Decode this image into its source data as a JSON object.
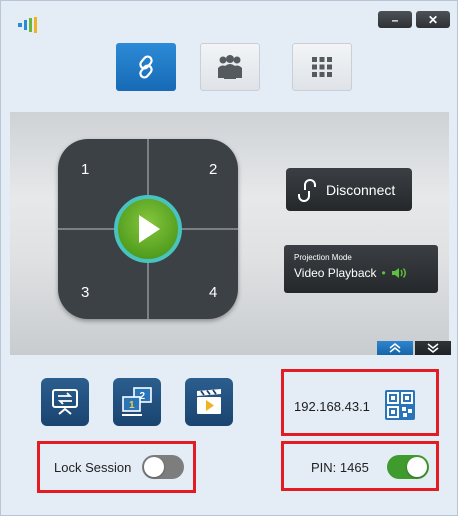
{
  "window": {
    "minimize_symbol": "–",
    "close_symbol": "✕",
    "accent": "#1d76c2"
  },
  "mode_tabs": [
    {
      "icon": "link-icon",
      "active": true
    },
    {
      "icon": "group-icon",
      "active": false
    },
    {
      "icon": "grid-icon",
      "active": false
    }
  ],
  "projection": {
    "quadrants": [
      "1",
      "2",
      "3",
      "4"
    ],
    "disconnect_label": "Disconnect",
    "mode_title": "Projection Mode",
    "mode_value": "Video Playback",
    "mode_dot": "•"
  },
  "tools": [
    {
      "icon": "screen-share-icon"
    },
    {
      "icon": "split-screen-icon"
    },
    {
      "icon": "video-clapper-icon"
    }
  ],
  "connection": {
    "ip": "192.168.43.1",
    "lock_label": "Lock Session",
    "lock_on": false,
    "pin_label": "PIN: 1465",
    "pin_on": true
  },
  "colors": {
    "highlight": "#e31b23",
    "toggle_on": "#3f9b2d",
    "toggle_off": "#7d7d7d",
    "play_green": "#5aa724"
  }
}
